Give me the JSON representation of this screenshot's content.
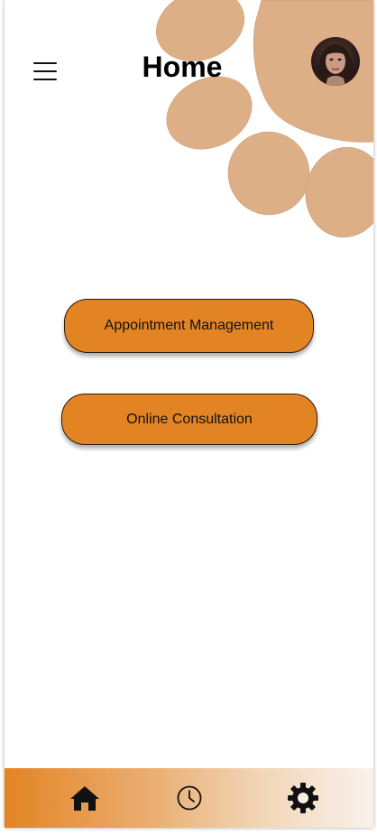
{
  "header": {
    "title": "Home",
    "menu_icon": "hamburger-menu-icon",
    "avatar_icon": "user-avatar"
  },
  "decoration": {
    "name": "paw-print-decoration",
    "color": "#dcaf87"
  },
  "actions": {
    "appointment_label": "Appointment Management",
    "consultation_label": "Online Consultation"
  },
  "bottom_nav": {
    "items": [
      {
        "icon": "home-icon"
      },
      {
        "icon": "clock-icon"
      },
      {
        "icon": "gear-icon"
      }
    ]
  },
  "colors": {
    "accent": "#e38424",
    "paw": "#dcaf87",
    "background": "#ffffff"
  }
}
